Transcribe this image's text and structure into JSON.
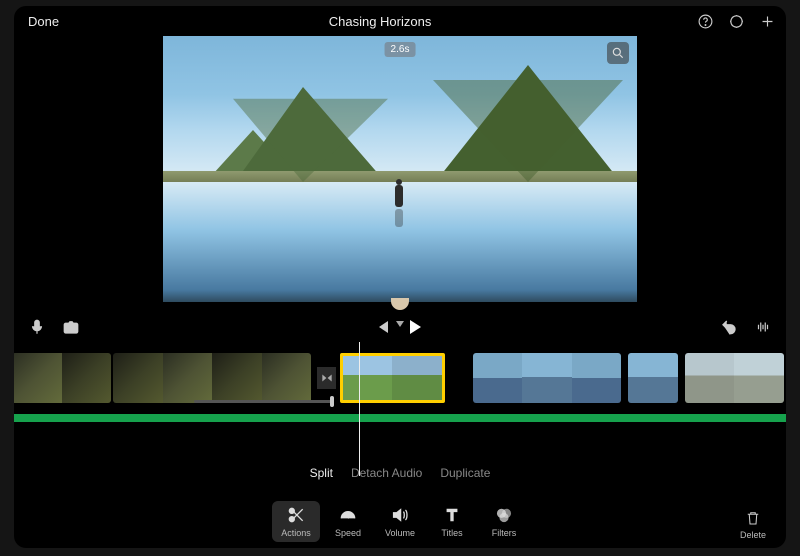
{
  "header": {
    "done_label": "Done",
    "title": "Chasing Horizons"
  },
  "preview": {
    "time_badge": "2.6s"
  },
  "edit_menu": {
    "split": "Split",
    "detach": "Detach Audio",
    "duplicate": "Duplicate"
  },
  "tools": {
    "actions": "Actions",
    "speed": "Speed",
    "volume": "Volume",
    "titles": "Titles",
    "filters": "Filters"
  },
  "delete_label": "Delete"
}
